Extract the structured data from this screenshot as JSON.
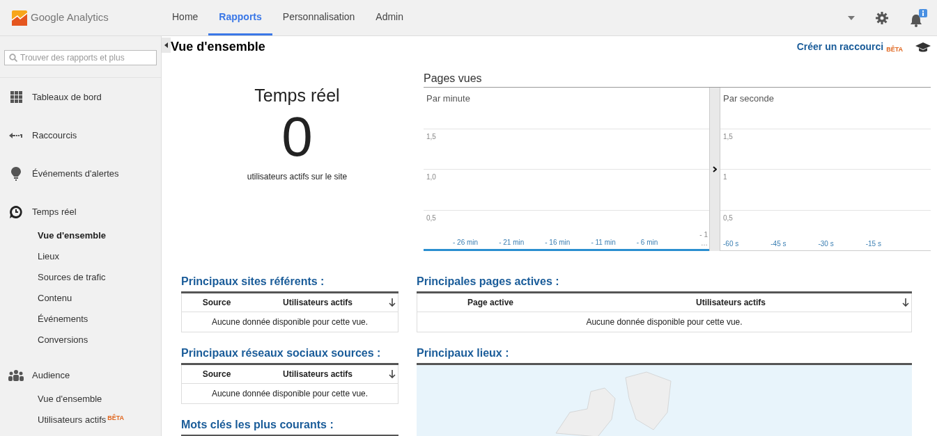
{
  "header": {
    "logo_text": "Google Analytics",
    "nav": [
      {
        "label": "Home",
        "selected": false
      },
      {
        "label": "Rapports",
        "selected": true
      },
      {
        "label": "Personnalisation",
        "selected": false
      },
      {
        "label": "Admin",
        "selected": false
      }
    ]
  },
  "sidebar": {
    "search": {
      "placeholder": "Trouver des rapports et plus"
    },
    "sections": [
      {
        "label": "Tableaux de bord"
      },
      {
        "label": "Raccourcis"
      },
      {
        "label": "Événements d'alertes"
      },
      {
        "label": "Temps réel",
        "children": [
          {
            "label": "Vue d'ensemble",
            "selected": true
          },
          {
            "label": "Lieux",
            "selected": false
          },
          {
            "label": "Sources de trafic",
            "selected": false
          },
          {
            "label": "Contenu",
            "selected": false
          },
          {
            "label": "Événements",
            "selected": false
          },
          {
            "label": "Conversions",
            "selected": false
          }
        ]
      },
      {
        "label": "Audience",
        "children": [
          {
            "label": "Vue d'ensemble",
            "selected": false
          },
          {
            "label": "Utilisateurs actifs",
            "badge": "BÊTA",
            "selected": false
          }
        ]
      }
    ]
  },
  "main": {
    "title": "Vue d'ensemble",
    "shortcut_link": "Créer un raccourci",
    "shortcut_badge": "BÊTA",
    "realtime": {
      "title": "Temps réel",
      "count": "0",
      "caption": "utilisateurs actifs sur le site"
    },
    "pageviews": {
      "title": "Pages vues",
      "per_minute": {
        "title": "Par minute",
        "y_labels": [
          "1,5",
          "1,0",
          "0,5"
        ],
        "x_labels": [
          "- 26 min",
          "- 21 min",
          "- 16 min",
          "- 11 min",
          "- 6 min"
        ],
        "x_last": "- 1 …"
      },
      "per_second": {
        "title": "Par seconde",
        "y_labels": [
          "1,5",
          "1",
          "0,5"
        ],
        "x_labels": [
          "-60 s",
          "-45 s",
          "-30 s",
          "-15 s"
        ]
      }
    },
    "left_tables": [
      {
        "kind": "table",
        "title": "Principaux sites référents :",
        "columns": [
          "Source",
          "Utilisateurs actifs"
        ],
        "empty": "Aucune donnée disponible pour cette vue."
      },
      {
        "kind": "table",
        "title": "Principaux réseaux sociaux sources :",
        "columns": [
          "Source",
          "Utilisateurs actifs"
        ],
        "empty": "Aucune donnée disponible pour cette vue."
      },
      {
        "kind": "heading",
        "title": "Mots clés les plus courants :"
      }
    ],
    "right_tables": [
      {
        "kind": "table",
        "title": "Principales pages actives :",
        "columns": [
          "Page active",
          "Utilisateurs actifs"
        ],
        "empty": "Aucune donnée disponible pour cette vue."
      },
      {
        "kind": "map",
        "title": "Principaux lieux :"
      }
    ]
  }
}
